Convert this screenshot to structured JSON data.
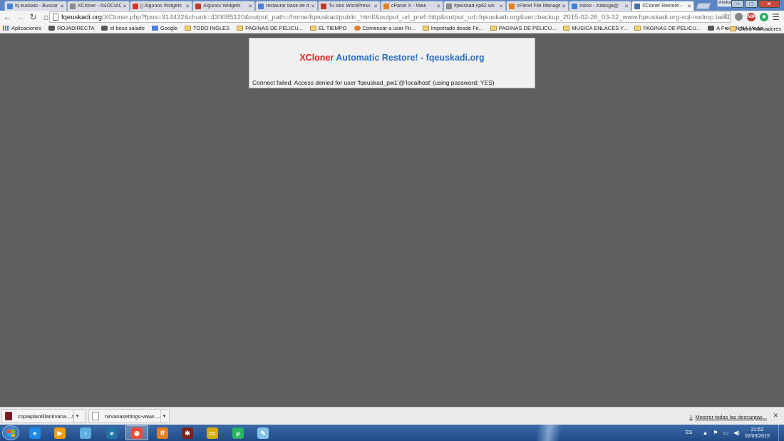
{
  "browser": {
    "tabs": [
      {
        "label": "fq euskadi - Buscar",
        "icon": "google-search-icon",
        "color": "#4a7fd6"
      },
      {
        "label": "XCloner - ASOCIAC",
        "icon": "page-icon",
        "color": "#8a8a8a"
      },
      {
        "label": "[] Algunos Widgets",
        "icon": "gmail-icon",
        "color": "#d93025"
      },
      {
        "label": "Algunos Widgets",
        "icon": "wordpress-icon",
        "color": "#c0392b"
      },
      {
        "label": "restaurar base de d",
        "icon": "google-search-icon",
        "color": "#4a7fd6"
      },
      {
        "label": "Tu sitio WordPress",
        "icon": "wordpress-icon",
        "color": "#c0392b"
      },
      {
        "label": "cPanel X - Main",
        "icon": "cpanel-icon",
        "color": "#e67e22"
      },
      {
        "label": "fqeuskad-cp62.wo",
        "icon": "page-icon",
        "color": "#8a8a8a"
      },
      {
        "label": "cPanel File Manager",
        "icon": "cpanel-icon",
        "color": "#e67e22"
      },
      {
        "label": "Inbox - ziaboga@",
        "icon": "mail-icon",
        "color": "#3b7dd8"
      },
      {
        "label": "XCloner Restore - ",
        "icon": "page-icon",
        "color": "#4a6fa5",
        "active": true
      }
    ],
    "window_user_label": "Anuka",
    "url_host": "fqeuskadi.org",
    "url_path": "/XCloner.php?fpos=914432&chunk=430085120&output_path=/home/fqeuskad/public_html/&output_url_pref=http&output_url=fqeuskadi.org&ver=backup_2015-02-26_03-32_www.fqeuskadi.org-sql-nodrop.tar&DB",
    "extensions": [
      {
        "name": "abp-icon",
        "label": "ABP",
        "color": "#c0392b"
      },
      {
        "name": "extension-green-icon",
        "label": "◉",
        "color": "#27ae60"
      }
    ],
    "bookmarks": [
      {
        "label": "Aplicaciones",
        "icon": "apps-grid-icon"
      },
      {
        "label": "ROJADIRECTA",
        "icon": "site-icon"
      },
      {
        "label": "el beso salado",
        "icon": "site-icon"
      },
      {
        "label": "Google",
        "icon": "google-icon"
      },
      {
        "label": "TODO INGLES",
        "icon": "folder-icon"
      },
      {
        "label": "PAGINAS DE PELICU...",
        "icon": "folder-icon"
      },
      {
        "label": "EL TIEMPO",
        "icon": "folder-icon"
      },
      {
        "label": "Comenzar a usar Fir...",
        "icon": "firefox-icon"
      },
      {
        "label": "Importado desde Fir...",
        "icon": "folder-icon"
      },
      {
        "label": "PAGINAS DE PELICU...",
        "icon": "folder-icon"
      },
      {
        "label": "MUSICA ENLACES Y...",
        "icon": "folder-icon"
      },
      {
        "label": "PAGINAS DE PELICU...",
        "icon": "folder-icon"
      },
      {
        "label": "A Free DLNA Media ...",
        "icon": "site-icon"
      }
    ],
    "bookmarks_overflow": "»",
    "other_bookmarks": "Otros marcadores"
  },
  "page": {
    "title_part1": "XCloner",
    "title_part2": "Automatic Restore! - fqeuskadi.org",
    "error": "Connect failed: Access denied for user 'fqeuskad_pw1'@'localhost' (using password: YES)"
  },
  "downloads": {
    "items": [
      {
        "name": "copiaplantillanirvana....tar",
        "icon": "archive-icon"
      },
      {
        "name": "nirvanasettings-www.....txt",
        "icon": "text-file-icon"
      }
    ],
    "show_all": "Mostrar todas las descargas..."
  },
  "taskbar": {
    "apps": [
      {
        "name": "internet-explorer-icon",
        "label": "e",
        "color": "#1e88e5"
      },
      {
        "name": "media-player-icon",
        "label": "▶",
        "color": "#f39c12"
      },
      {
        "name": "itunes-icon",
        "label": "♪",
        "color": "#5dade2"
      },
      {
        "name": "ie-legacy-icon",
        "label": "e",
        "color": "#2471a3"
      },
      {
        "name": "chrome-icon",
        "label": "◉",
        "color": "#e74c3c"
      },
      {
        "name": "firefox-icon",
        "label": "ff",
        "color": "#e67e22"
      },
      {
        "name": "utility-icon",
        "label": "✱",
        "color": "#7b241c"
      },
      {
        "name": "file-explorer-icon",
        "label": "▭",
        "color": "#d4ac0d"
      },
      {
        "name": "utorrent-icon",
        "label": "µ",
        "color": "#28b463"
      },
      {
        "name": "notepad-icon",
        "label": "✎",
        "color": "#85c1e9"
      }
    ],
    "language": "ES",
    "time": "21:52",
    "date": "02/03/2015"
  }
}
